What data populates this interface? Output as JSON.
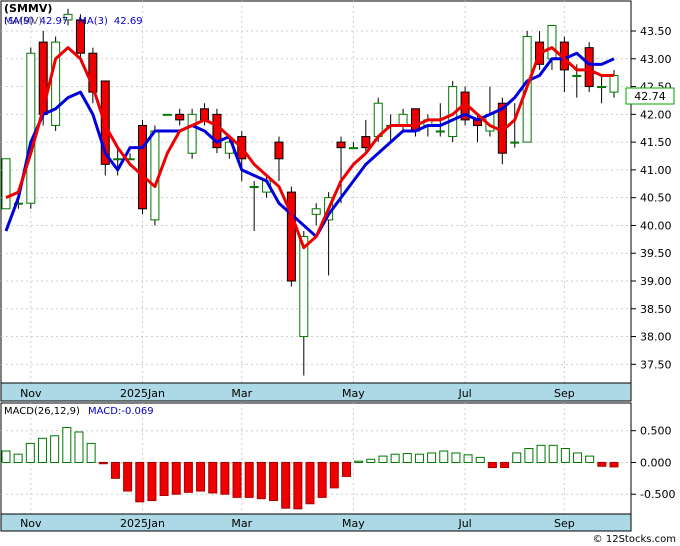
{
  "chart_data": [
    {
      "type": "candlestick",
      "title": "(SMMV)",
      "indicators": [
        {
          "name": "MA(9)",
          "value": "42.97",
          "color": "#0000cc"
        },
        {
          "name": "MA(3)",
          "value": "42.69",
          "color": "#0000cc"
        }
      ],
      "last_price": "42.74",
      "y_ticks": [
        "43.50",
        "43.00",
        "42.50",
        "42.00",
        "41.50",
        "41.00",
        "40.50",
        "40.00",
        "39.50",
        "39.00",
        "38.50",
        "38.00",
        "37.50"
      ],
      "ylim": [
        37.2,
        43.95
      ],
      "x_ticks": [
        {
          "label": "Nov",
          "index": 2
        },
        {
          "label": "2025Jan",
          "index": 11
        },
        {
          "label": "Mar",
          "index": 19
        },
        {
          "label": "May",
          "index": 28
        },
        {
          "label": "Jul",
          "index": 37
        },
        {
          "label": "Sep",
          "index": 45
        }
      ],
      "candles": [
        [
          40.3,
          41.2,
          40.3,
          41.2
        ],
        [
          40.4,
          40.4,
          40.3,
          40.5
        ],
        [
          40.4,
          43.1,
          40.3,
          43.2
        ],
        [
          43.3,
          42.0,
          41.8,
          43.5
        ],
        [
          41.8,
          43.3,
          41.7,
          43.4
        ],
        [
          43.7,
          43.8,
          43.6,
          43.9
        ],
        [
          43.7,
          43.1,
          43.0,
          43.8
        ],
        [
          43.1,
          42.4,
          42.2,
          43.2
        ],
        [
          42.6,
          41.1,
          40.9,
          42.6
        ],
        [
          41.2,
          41.2,
          40.9,
          41.4
        ],
        [
          41.2,
          41.2,
          41.2,
          41.3
        ],
        [
          41.8,
          40.3,
          40.2,
          41.9
        ],
        [
          40.1,
          41.7,
          40.0,
          41.8
        ],
        [
          42.0,
          42.0,
          42.0,
          42.0
        ],
        [
          42.0,
          41.9,
          41.8,
          42.1
        ],
        [
          41.3,
          42.0,
          41.2,
          42.1
        ],
        [
          42.1,
          41.9,
          41.8,
          42.2
        ],
        [
          42.0,
          41.4,
          41.3,
          42.1
        ],
        [
          41.3,
          41.5,
          41.2,
          41.6
        ],
        [
          41.6,
          41.2,
          40.8,
          41.7
        ],
        [
          40.7,
          40.7,
          39.9,
          40.8
        ],
        [
          40.6,
          40.8,
          40.5,
          40.9
        ],
        [
          41.5,
          41.2,
          40.8,
          41.6
        ],
        [
          40.6,
          39.0,
          38.9,
          40.7
        ],
        [
          38.0,
          39.8,
          37.3,
          39.9
        ],
        [
          40.2,
          40.3,
          40.0,
          40.4
        ],
        [
          40.1,
          40.5,
          39.1,
          40.6
        ],
        [
          41.5,
          41.4,
          40.4,
          41.6
        ],
        [
          41.4,
          41.4,
          41.4,
          41.5
        ],
        [
          41.6,
          41.4,
          41.3,
          41.9
        ],
        [
          41.6,
          42.2,
          41.5,
          42.3
        ],
        [
          41.8,
          41.8,
          41.5,
          42.0
        ],
        [
          41.8,
          42.0,
          41.7,
          42.1
        ],
        [
          42.1,
          41.7,
          41.6,
          42.1
        ],
        [
          41.8,
          41.9,
          41.6,
          42.0
        ],
        [
          41.7,
          41.7,
          41.6,
          42.2
        ],
        [
          41.6,
          42.5,
          41.5,
          42.6
        ],
        [
          42.4,
          41.9,
          41.8,
          42.5
        ],
        [
          41.9,
          41.8,
          41.5,
          42.0
        ],
        [
          41.7,
          42.0,
          41.6,
          42.5
        ],
        [
          42.2,
          41.3,
          41.1,
          42.3
        ],
        [
          41.5,
          41.5,
          41.4,
          42.2
        ],
        [
          41.5,
          43.4,
          41.5,
          43.5
        ],
        [
          43.3,
          42.9,
          42.8,
          43.5
        ],
        [
          43.0,
          43.6,
          42.8,
          43.6
        ],
        [
          43.3,
          42.8,
          42.4,
          43.4
        ],
        [
          42.7,
          42.7,
          42.3,
          42.9
        ],
        [
          43.2,
          42.5,
          42.4,
          43.3
        ],
        [
          42.5,
          42.5,
          42.2,
          42.7
        ],
        [
          42.4,
          42.7,
          42.3,
          42.8
        ]
      ],
      "series": [
        {
          "name": "MA(9)",
          "color": "#0000dd",
          "values": [
            39.9,
            40.5,
            41.5,
            42.0,
            42.1,
            42.3,
            42.4,
            42.0,
            41.3,
            41.0,
            41.4,
            41.4,
            41.7,
            41.7,
            41.7,
            41.8,
            41.7,
            41.5,
            41.6,
            41.0,
            40.9,
            40.8,
            40.4,
            40.2,
            40.0,
            39.8,
            40.2,
            40.5,
            40.8,
            41.1,
            41.3,
            41.5,
            41.7,
            41.7,
            41.8,
            41.8,
            41.9,
            42.0,
            41.9,
            42.0,
            42.1,
            42.3,
            42.6,
            42.7,
            43.0,
            43.0,
            43.1,
            42.9,
            42.9,
            43.0
          ]
        },
        {
          "name": "MA(3)",
          "color": "#ee0000",
          "values": [
            40.5,
            40.6,
            41.3,
            42.1,
            43.0,
            43.2,
            43.0,
            42.5,
            41.8,
            41.4,
            41.1,
            40.9,
            40.7,
            41.3,
            41.7,
            41.8,
            41.9,
            41.8,
            41.6,
            41.4,
            41.1,
            40.9,
            40.7,
            40.2,
            39.6,
            39.8,
            40.3,
            40.8,
            41.1,
            41.3,
            41.6,
            41.8,
            41.8,
            41.8,
            41.9,
            41.9,
            42.0,
            42.2,
            42.0,
            41.8,
            41.7,
            41.9,
            42.5,
            43.1,
            43.2,
            43.0,
            42.8,
            42.8,
            42.7,
            42.7
          ]
        }
      ]
    },
    {
      "type": "bar",
      "title": "MACD(26,12,9)",
      "indicator_label": "MACD:",
      "indicator_value": "-0.069",
      "y_ticks": [
        "0.500",
        "0.000",
        "-0.500"
      ],
      "ylim": [
        -0.78,
        0.7
      ],
      "x_ticks": [
        {
          "label": "Nov",
          "index": 2
        },
        {
          "label": "2025Jan",
          "index": 11
        },
        {
          "label": "Mar",
          "index": 19
        },
        {
          "label": "May",
          "index": 28
        },
        {
          "label": "Jul",
          "index": 37
        },
        {
          "label": "Sep",
          "index": 45
        }
      ],
      "values": [
        0.18,
        0.13,
        0.3,
        0.38,
        0.42,
        0.55,
        0.48,
        0.3,
        -0.02,
        -0.25,
        -0.45,
        -0.62,
        -0.6,
        -0.52,
        -0.5,
        -0.47,
        -0.45,
        -0.48,
        -0.5,
        -0.55,
        -0.55,
        -0.57,
        -0.6,
        -0.72,
        -0.73,
        -0.65,
        -0.55,
        -0.4,
        -0.22,
        0.02,
        0.05,
        0.1,
        0.13,
        0.14,
        0.13,
        0.15,
        0.18,
        0.15,
        0.12,
        0.08,
        -0.08,
        -0.08,
        0.15,
        0.22,
        0.27,
        0.27,
        0.22,
        0.15,
        0.1,
        -0.06,
        -0.07
      ],
      "positive_color": "#ffffff",
      "negative_color": "#ee0000"
    }
  ],
  "footer": "© 12Stocks.com"
}
